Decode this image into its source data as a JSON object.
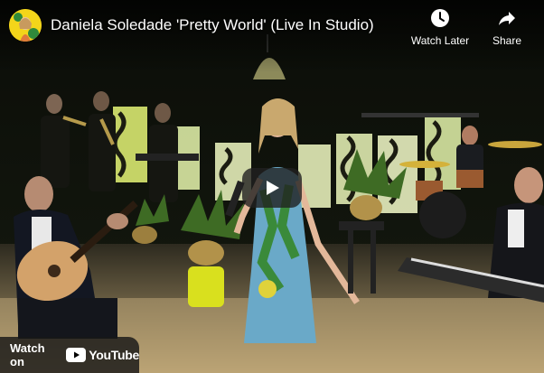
{
  "video": {
    "title": "Daniela Soledade 'Pretty World' (Live In Studio)"
  },
  "actions": {
    "watch_later_label": "Watch Later",
    "share_label": "Share"
  },
  "bottom": {
    "watch_on_label": "Watch on",
    "youtube_label": "YouTube"
  },
  "icons": {
    "avatar": "channel-avatar-icon",
    "watch_later": "clock-icon",
    "share": "share-arrow-icon",
    "play": "play-icon",
    "youtube": "youtube-logo-icon"
  },
  "colors": {
    "play_button_bg": "#212121",
    "youtube_red": "#ff0000",
    "avatar_bg": "#f3d51a"
  }
}
